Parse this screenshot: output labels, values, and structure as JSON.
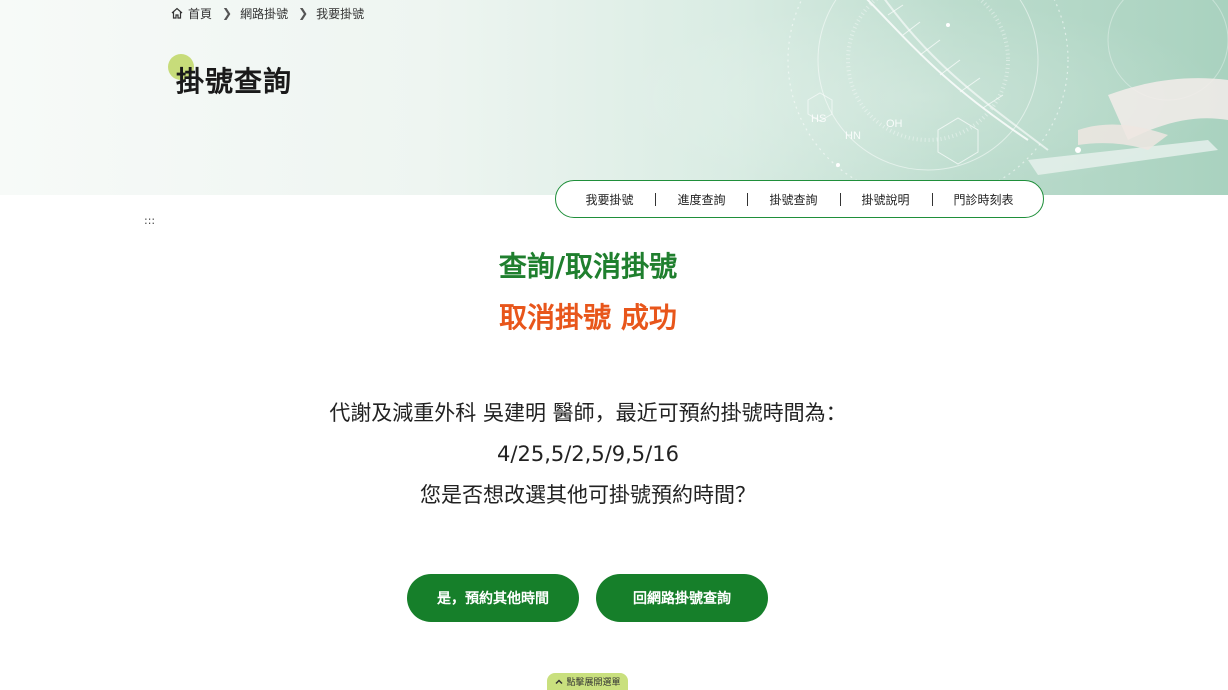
{
  "breadcrumb": {
    "home": "首頁",
    "items": [
      "網路掛號",
      "我要掛號"
    ]
  },
  "page_title": "掛號查詢",
  "subnav": {
    "items": [
      "我要掛號",
      "進度查詢",
      "掛號查詢",
      "掛號說明",
      "門診時刻表"
    ]
  },
  "accesskey": ":::",
  "content": {
    "heading": "查詢/取消掛號",
    "status": "取消掛號 成功",
    "message_line1": "代謝及減重外科 吳建明 醫師，最近可預約掛號時間為：",
    "message_line2": "4/25,5/2,5/9,5/16",
    "message_line3": "您是否想改選其他可掛號預約時間？"
  },
  "buttons": {
    "yes": "是，預約其他時間",
    "back": "回網路掛號查詢"
  },
  "expand_menu": "點擊展開選單",
  "banner_art_labels": {
    "hs": "HS",
    "hn": "HN",
    "oh": "OH"
  },
  "icons": {
    "home": "home-icon",
    "breadcrumb_sep": "chevron-right-icon",
    "expand": "chevron-up-icon"
  },
  "colors": {
    "primary_green": "#167f2a",
    "heading_green": "#1f7f2e",
    "status_orange": "#e8561b",
    "accent_lime": "#c7dc7a"
  }
}
